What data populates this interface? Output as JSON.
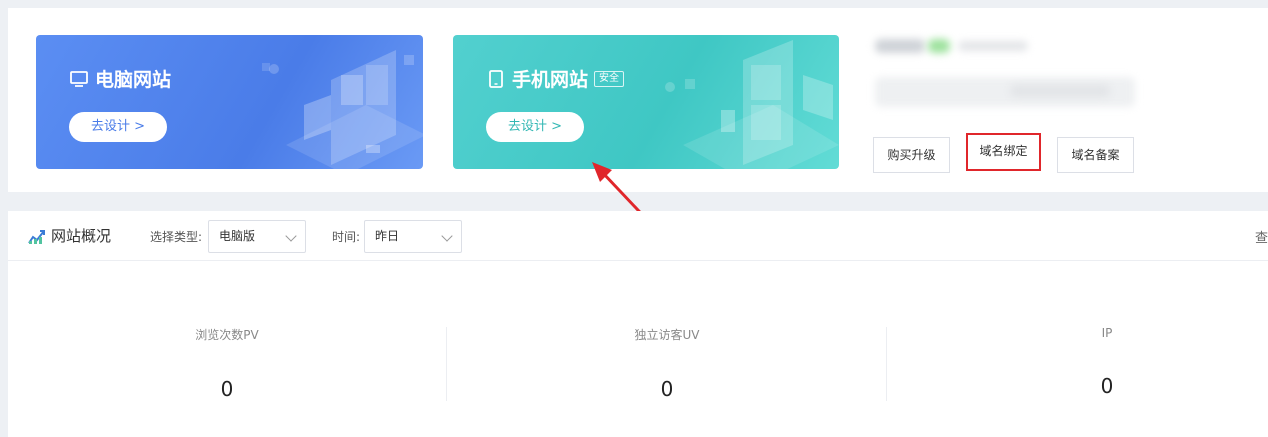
{
  "sites": {
    "pc": {
      "title": "电脑网站",
      "design_label": "去设计 >",
      "icon": "monitor-icon"
    },
    "mobile": {
      "title": "手机网站",
      "badge": "安全",
      "design_label": "去设计 >",
      "icon": "phone-icon"
    }
  },
  "actions": {
    "buy_upgrade": "购买升级",
    "domain_binding": "域名绑定",
    "domain_record": "域名备案"
  },
  "overview": {
    "title": "网站概况",
    "type_label": "选择类型:",
    "type_value": "电脑版",
    "time_label": "时间:",
    "time_value": "昨日",
    "more": "查",
    "stats": [
      {
        "label": "浏览次数PV",
        "value": "0"
      },
      {
        "label": "独立访客UV",
        "value": "0"
      },
      {
        "label": "IP",
        "value": "0"
      }
    ]
  },
  "colors": {
    "pc_card": "#4a7ce8",
    "mobile_card": "#3fc7c4",
    "highlight": "#e0262b"
  }
}
